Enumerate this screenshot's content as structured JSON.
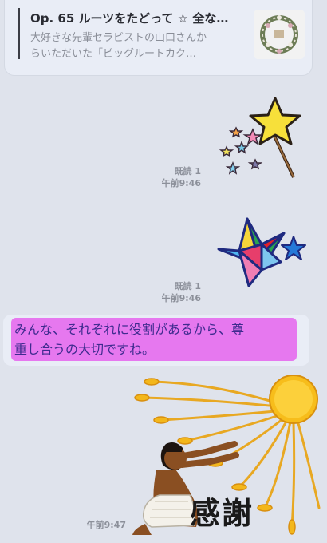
{
  "link_card": {
    "title": "Op. 65 ルーツをたどって ☆ 全な…",
    "description_line1": "大好きな先輩セラピストの山口さんか",
    "description_line2": "らいただいた「ビッグルートカク…"
  },
  "messages": [
    {
      "type": "sticker",
      "sticker_icon": "magic-wand-star",
      "read": "既読 1",
      "time": "午前9:46"
    },
    {
      "type": "sticker",
      "sticker_icon": "colorful-star",
      "read": "既読 1",
      "time": "午前9:46"
    },
    {
      "type": "text",
      "line1": "みんな、それぞれに役割があるから、尊",
      "line2": "重し合うの大切ですね。"
    },
    {
      "type": "sticker",
      "sticker_icon": "sun-worship-thanks",
      "sticker_text": "感謝",
      "time": "午前9:47"
    }
  ],
  "colors": {
    "background": "#dfe3ec",
    "bubble": "#e9edf6",
    "highlight": "#e678ef",
    "text_highlighted": "#3f2b8f"
  }
}
